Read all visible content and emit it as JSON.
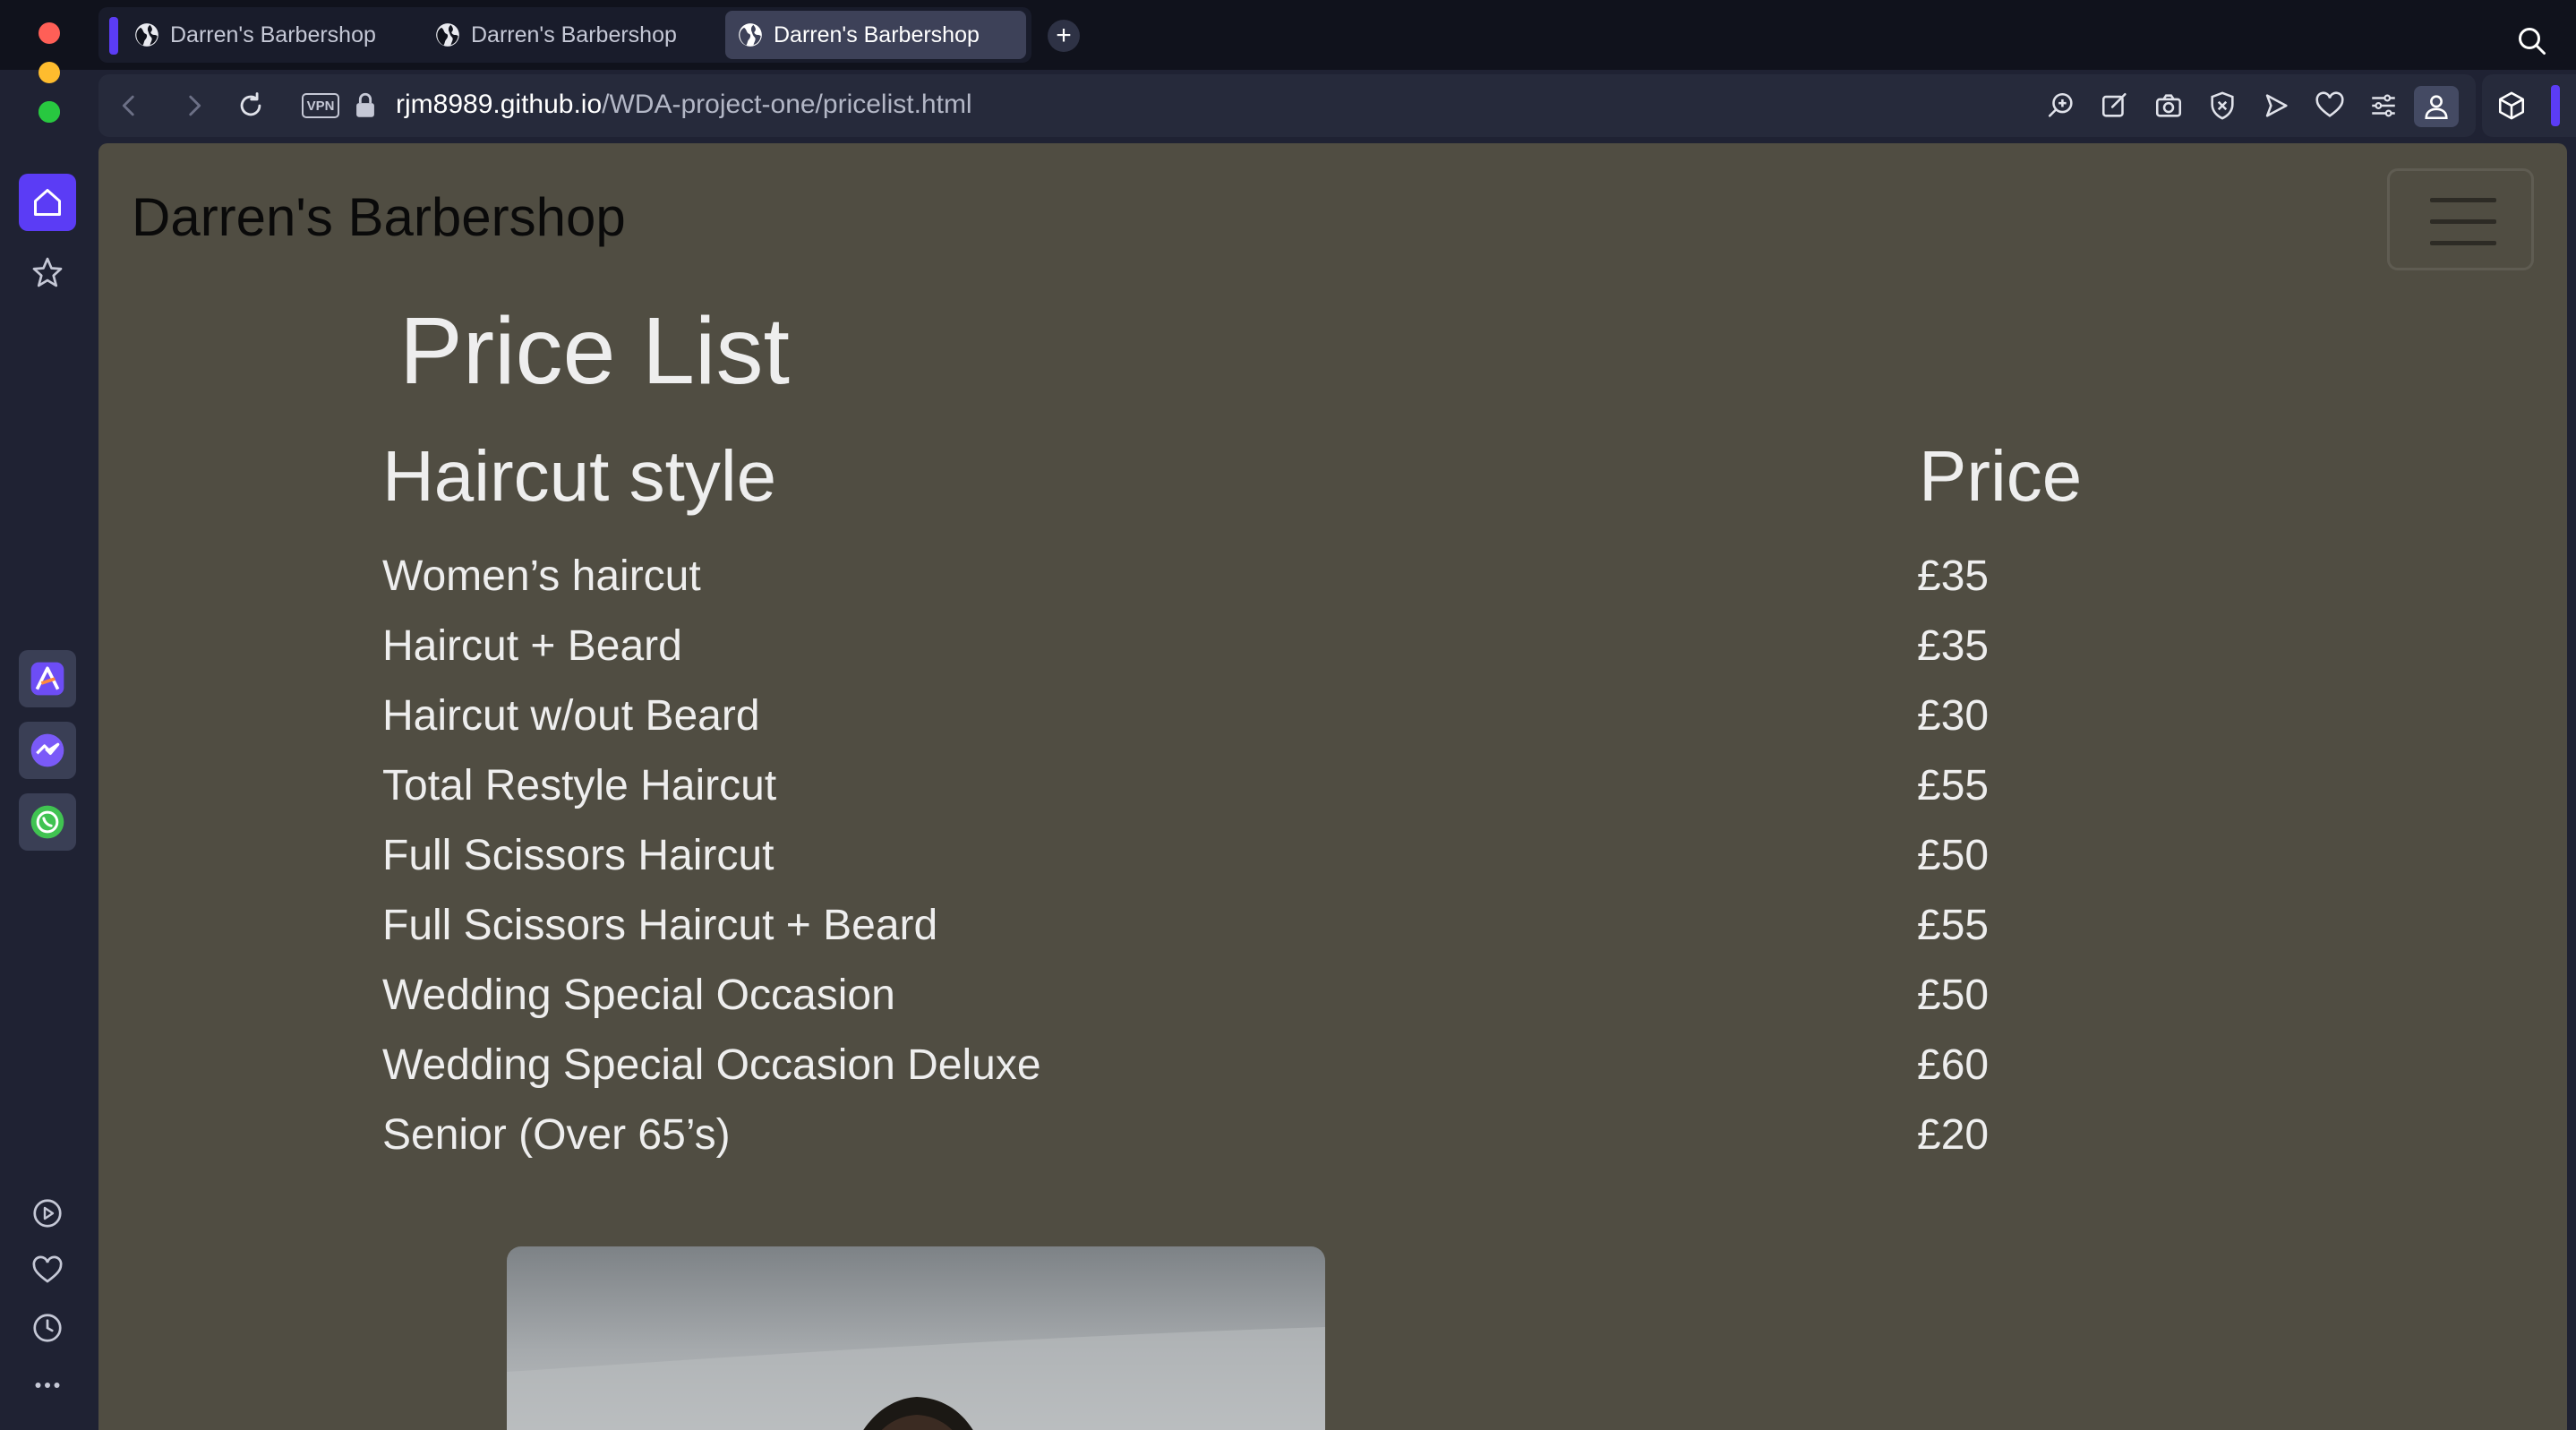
{
  "browser": {
    "tabs": [
      {
        "title": "Darren's Barbershop",
        "active": false
      },
      {
        "title": "Darren's Barbershop",
        "active": false
      },
      {
        "title": "Darren's Barbershop",
        "active": true
      }
    ],
    "new_tab_label": "+",
    "vpn_label": "VPN",
    "url": {
      "host": "rjm8989.github.io",
      "path": "/WDA-project-one/pricelist.html"
    },
    "accent_color": "#5b3cf5"
  },
  "page": {
    "site_title": "Darren's Barbershop",
    "heading": "Price List",
    "columns": {
      "style": "Haircut style",
      "price": "Price"
    },
    "rows": [
      {
        "style": "Women’s haircut",
        "price": "£35"
      },
      {
        "style": "Haircut + Beard",
        "price": "£35"
      },
      {
        "style": "Haircut w/out Beard",
        "price": "£30"
      },
      {
        "style": "Total Restyle Haircut",
        "price": "£55"
      },
      {
        "style": "Full Scissors Haircut",
        "price": "£50"
      },
      {
        "style": "Full Scissors Haircut + Beard",
        "price": "£55"
      },
      {
        "style": "Wedding Special Occasion",
        "price": "£50"
      },
      {
        "style": "Wedding Special Occasion Deluxe",
        "price": "£60"
      },
      {
        "style": "Senior (Over 65’s)",
        "price": "£20"
      }
    ],
    "background_color": "#504d42",
    "text_color": "#eeeeee"
  }
}
